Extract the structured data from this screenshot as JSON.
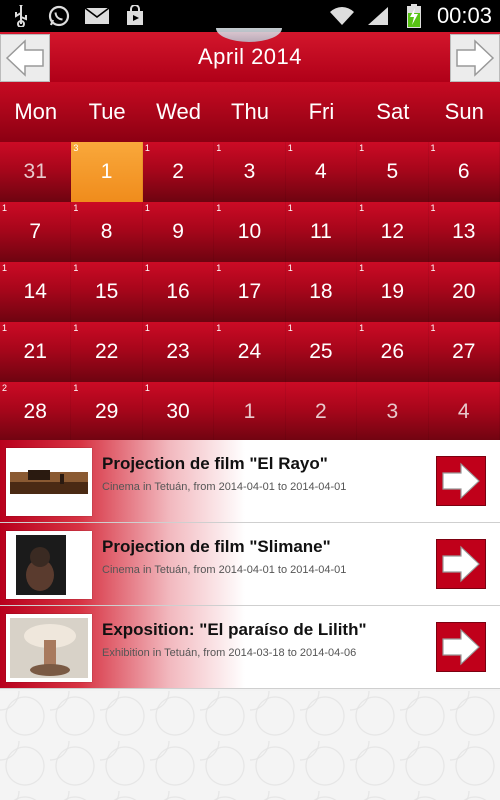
{
  "status_bar": {
    "time": "00:03",
    "left_icons": [
      "usb-icon",
      "whatsapp-icon",
      "mail-icon",
      "store-icon"
    ],
    "right_icons": [
      "wifi-icon",
      "signal-icon",
      "battery-charging-icon"
    ]
  },
  "header": {
    "month_title": "April 2014",
    "prev_icon": "arrow-left-icon",
    "next_icon": "arrow-right-icon"
  },
  "calendar": {
    "weekdays": [
      "Mon",
      "Tue",
      "Wed",
      "Thu",
      "Fri",
      "Sat",
      "Sun"
    ],
    "weeks": [
      [
        {
          "day": "31",
          "badge": "",
          "other": true,
          "today": false
        },
        {
          "day": "1",
          "badge": "3",
          "other": false,
          "today": true
        },
        {
          "day": "2",
          "badge": "1",
          "other": false,
          "today": false
        },
        {
          "day": "3",
          "badge": "1",
          "other": false,
          "today": false
        },
        {
          "day": "4",
          "badge": "1",
          "other": false,
          "today": false
        },
        {
          "day": "5",
          "badge": "1",
          "other": false,
          "today": false
        },
        {
          "day": "6",
          "badge": "1",
          "other": false,
          "today": false
        }
      ],
      [
        {
          "day": "7",
          "badge": "1",
          "other": false,
          "today": false
        },
        {
          "day": "8",
          "badge": "1",
          "other": false,
          "today": false
        },
        {
          "day": "9",
          "badge": "1",
          "other": false,
          "today": false
        },
        {
          "day": "10",
          "badge": "1",
          "other": false,
          "today": false
        },
        {
          "day": "11",
          "badge": "1",
          "other": false,
          "today": false
        },
        {
          "day": "12",
          "badge": "1",
          "other": false,
          "today": false
        },
        {
          "day": "13",
          "badge": "1",
          "other": false,
          "today": false
        }
      ],
      [
        {
          "day": "14",
          "badge": "1",
          "other": false,
          "today": false
        },
        {
          "day": "15",
          "badge": "1",
          "other": false,
          "today": false
        },
        {
          "day": "16",
          "badge": "1",
          "other": false,
          "today": false
        },
        {
          "day": "17",
          "badge": "1",
          "other": false,
          "today": false
        },
        {
          "day": "18",
          "badge": "1",
          "other": false,
          "today": false
        },
        {
          "day": "19",
          "badge": "1",
          "other": false,
          "today": false
        },
        {
          "day": "20",
          "badge": "1",
          "other": false,
          "today": false
        }
      ],
      [
        {
          "day": "21",
          "badge": "1",
          "other": false,
          "today": false
        },
        {
          "day": "22",
          "badge": "1",
          "other": false,
          "today": false
        },
        {
          "day": "23",
          "badge": "1",
          "other": false,
          "today": false
        },
        {
          "day": "24",
          "badge": "1",
          "other": false,
          "today": false
        },
        {
          "day": "25",
          "badge": "1",
          "other": false,
          "today": false
        },
        {
          "day": "26",
          "badge": "1",
          "other": false,
          "today": false
        },
        {
          "day": "27",
          "badge": "1",
          "other": false,
          "today": false
        }
      ],
      [
        {
          "day": "28",
          "badge": "2",
          "other": false,
          "today": false
        },
        {
          "day": "29",
          "badge": "1",
          "other": false,
          "today": false
        },
        {
          "day": "30",
          "badge": "1",
          "other": false,
          "today": false
        },
        {
          "day": "1",
          "badge": "",
          "other": true,
          "today": false
        },
        {
          "day": "2",
          "badge": "",
          "other": true,
          "today": false
        },
        {
          "day": "3",
          "badge": "",
          "other": true,
          "today": false
        },
        {
          "day": "4",
          "badge": "",
          "other": true,
          "today": false
        }
      ]
    ]
  },
  "events": [
    {
      "title": "Projection de film \"El Rayo\"",
      "subtitle": "Cinema in Tetuán, from 2014-04-01 to 2014-04-01",
      "thumb_icon": "film-thumbnail"
    },
    {
      "title": "Projection de film \"Slimane\"",
      "subtitle": "Cinema in Tetuán, from 2014-04-01 to 2014-04-01",
      "thumb_icon": "film-thumbnail"
    },
    {
      "title": "Exposition: \"El paraíso de Lilith\"",
      "subtitle": "Exhibition in Tetuán, from 2014-03-18 to 2014-04-06",
      "thumb_icon": "artwork-thumbnail"
    }
  ],
  "colors": {
    "brand_red": "#c0001a",
    "today_orange": "#f39a2a"
  }
}
